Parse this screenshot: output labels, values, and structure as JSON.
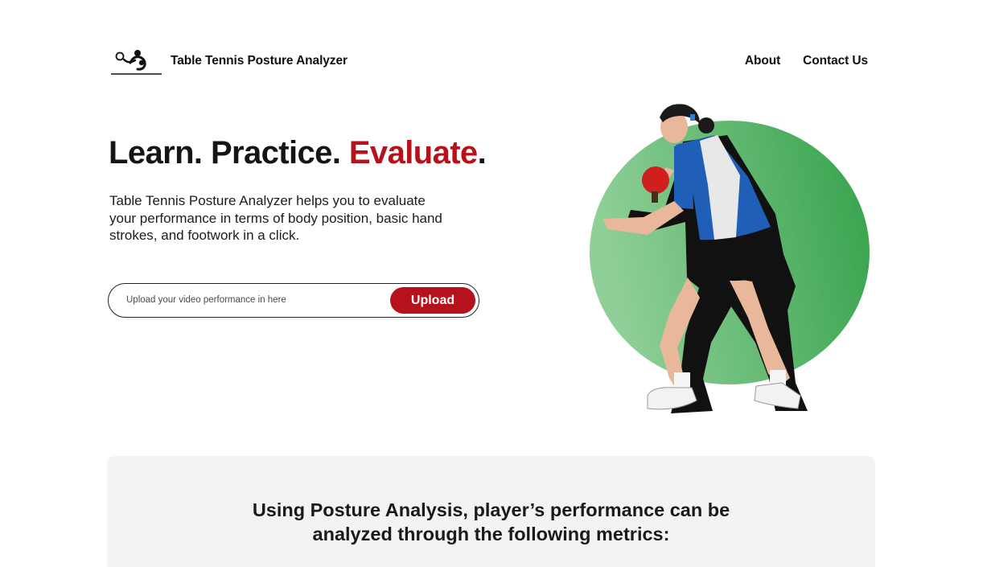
{
  "header": {
    "logo_icon": "ping-pong-player-logo-icon",
    "brand": "Table Tennis Posture Analyzer",
    "nav": [
      {
        "label": "About"
      },
      {
        "label": "Contact Us"
      }
    ]
  },
  "hero": {
    "title_part1": "Learn. Practice. ",
    "title_accent": "Evaluate",
    "title_end": ".",
    "description": "Table Tennis Posture Analyzer helps you to evaluate your performance in terms of body position, basic hand strokes, and footwork in a click.",
    "upload": {
      "placeholder": "Upload your video performance in here",
      "button_label": "Upload"
    },
    "image_icon": "table-tennis-player-illustration"
  },
  "metrics": {
    "heading_line1": "Using Posture Analysis, player’s performance can be",
    "heading_line2": "analyzed through the following metrics:"
  },
  "colors": {
    "accent": "#b5121b",
    "green_light": "#8fcf98",
    "green_dark": "#34a14a",
    "section_bg": "#f3f3f3"
  }
}
